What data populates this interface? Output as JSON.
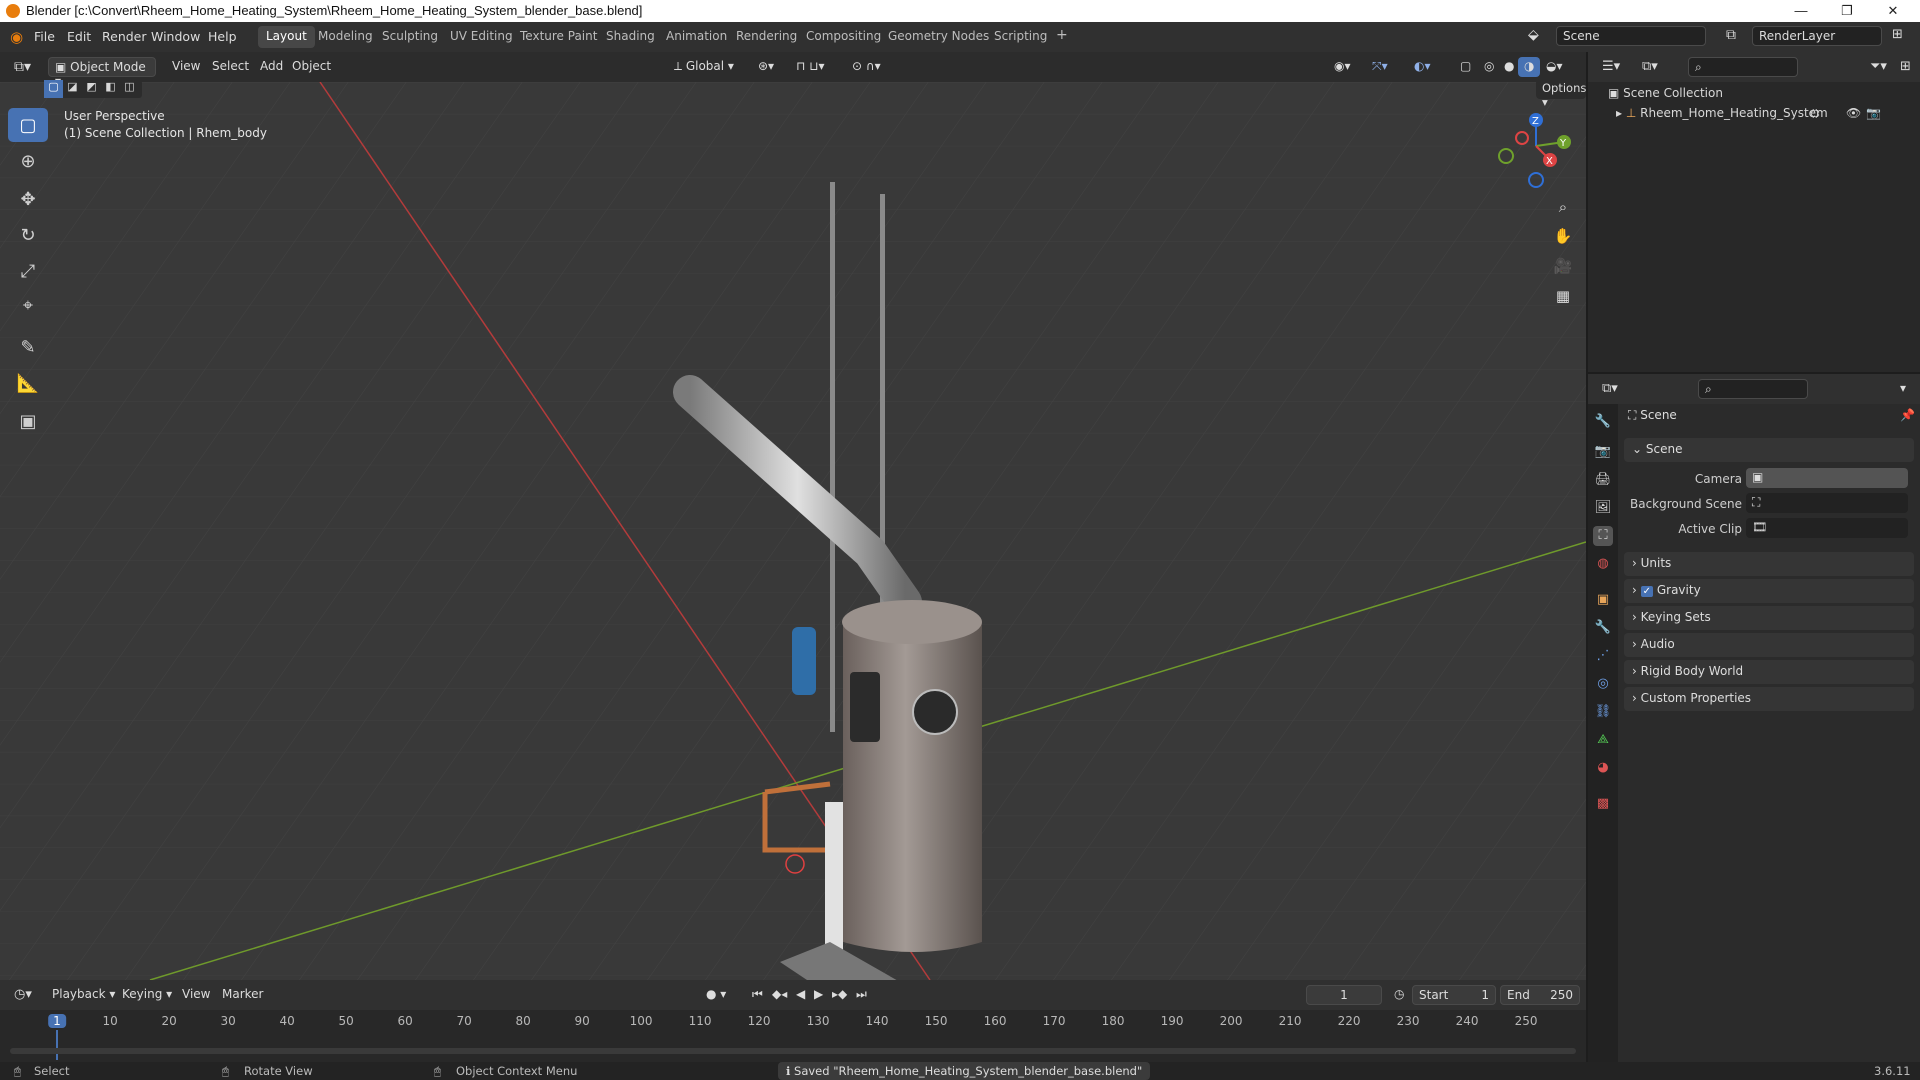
{
  "window": {
    "title": "Blender [c:\\Convert\\Rheem_Home_Heating_System\\Rheem_Home_Heating_System_blender_base.blend]",
    "controls": [
      "—",
      "❐",
      "✕"
    ]
  },
  "menu": [
    "File",
    "Edit",
    "Render",
    "Window",
    "Help"
  ],
  "workspaces": {
    "tabs": [
      "Layout",
      "Modeling",
      "Sculpting",
      "UV Editing",
      "Texture Paint",
      "Shading",
      "Animation",
      "Rendering",
      "Compositing",
      "Geometry Nodes",
      "Scripting"
    ],
    "active": "Layout",
    "add": "+"
  },
  "scene_selector": {
    "label": "Scene"
  },
  "view_layer_selector": {
    "label": "RenderLayer"
  },
  "viewport_header": {
    "mode": "Object Mode",
    "menus": [
      "View",
      "Select",
      "Add",
      "Object"
    ],
    "orientation": "Global"
  },
  "viewport": {
    "perspective": "User Perspective",
    "context": "(1) Scene Collection | Rhem_body",
    "options_label": "Options",
    "gizmo_axes": [
      "X",
      "Y",
      "Z"
    ]
  },
  "toolbar": {
    "tools": [
      {
        "name": "select-box",
        "icon": "▢",
        "active": true
      },
      {
        "name": "cursor",
        "icon": "⊕",
        "active": false
      },
      {
        "name": "move",
        "icon": "✥",
        "active": false
      },
      {
        "name": "rotate",
        "icon": "↻",
        "active": false
      },
      {
        "name": "scale",
        "icon": "⤢",
        "active": false
      },
      {
        "name": "transform",
        "icon": "⌖",
        "active": false
      },
      {
        "name": "annotate",
        "icon": "✎",
        "active": false
      },
      {
        "name": "measure",
        "icon": "📐",
        "active": false
      },
      {
        "name": "add-cube",
        "icon": "▣",
        "active": false
      }
    ]
  },
  "outliner": {
    "root": "Scene Collection",
    "items": [
      {
        "label": "Rheem_Home_Heating_System"
      }
    ]
  },
  "properties": {
    "context_title": "Scene",
    "section_scene": "Scene",
    "rows": [
      {
        "label": "Camera",
        "value": ""
      },
      {
        "label": "Background Scene",
        "value": ""
      },
      {
        "label": "Active Clip",
        "value": ""
      }
    ],
    "panels": [
      "Units",
      "Gravity",
      "Keying Sets",
      "Audio",
      "Rigid Body World",
      "Custom Properties"
    ]
  },
  "timeline": {
    "menus": [
      "Playback",
      "Keying",
      "View",
      "Marker"
    ],
    "current_frame": "1",
    "start_label": "Start",
    "start": "1",
    "end_label": "End",
    "end": "250",
    "ticks": [
      "1",
      "10",
      "20",
      "30",
      "40",
      "50",
      "60",
      "70",
      "80",
      "90",
      "100",
      "110",
      "120",
      "130",
      "140",
      "150",
      "160",
      "170",
      "180",
      "190",
      "200",
      "210",
      "220",
      "230",
      "240",
      "250"
    ]
  },
  "statusbar": {
    "select": "Select",
    "rotate": "Rotate View",
    "context_menu": "Object Context Menu",
    "message": "Saved \"Rheem_Home_Heating_System_blender_base.blend\"",
    "version": "3.6.11"
  }
}
